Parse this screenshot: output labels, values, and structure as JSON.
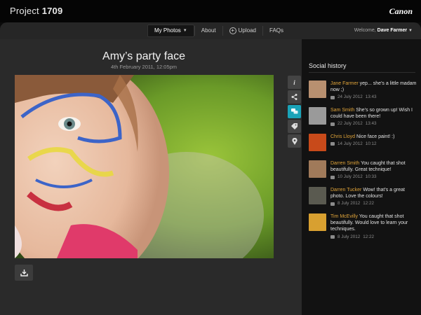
{
  "header": {
    "brand_prefix": "Project",
    "brand_number": "1709",
    "logo_text": "Canon"
  },
  "nav": {
    "items": [
      {
        "label": "My Photos",
        "active": true
      },
      {
        "label": "About"
      },
      {
        "label": "Upload"
      },
      {
        "label": "FAQs"
      }
    ],
    "welcome_prefix": "Welcome,",
    "welcome_user": "Dave Farmer"
  },
  "photo": {
    "title": "Amy’s party face",
    "date": "4th February 2011, 12:05pm"
  },
  "tools": [
    "info-icon",
    "share-icon",
    "comments-icon",
    "tag-icon",
    "location-icon"
  ],
  "sidebar": {
    "title": "Social history",
    "entries": [
      {
        "name": "Jane Farmer",
        "text": "yep... she’s a little madam now ;)",
        "date": "24 July 2012",
        "time": "13:43",
        "avatar_color": "#b89070"
      },
      {
        "name": "Sam Smith",
        "text": "She’s so grown up! Wish I could have been there!",
        "date": "22 July 2012",
        "time": "13:43",
        "avatar_color": "#9a9a9a"
      },
      {
        "name": "Chris Lloyd",
        "text": "Nice face paint! :)",
        "date": "14 July 2012",
        "time": "10:12",
        "avatar_color": "#c84a1a"
      },
      {
        "name": "Darren Smith",
        "text": "You caught that shot beautifully. Great technique!",
        "date": "10 July 2012",
        "time": "10:33",
        "avatar_color": "#a07a5a"
      },
      {
        "name": "Darren Tucker",
        "text": "Wow! that’s a great photo. Love the colours!",
        "date": "8 July 2012",
        "time": "12:22",
        "avatar_color": "#5a5a50"
      },
      {
        "name": "Tim McEvilly",
        "text": "You caught that shot beautifully. Would love to learn your techniques.",
        "date": "8 July 2012",
        "time": "12:22",
        "avatar_color": "#d8a030"
      }
    ]
  }
}
